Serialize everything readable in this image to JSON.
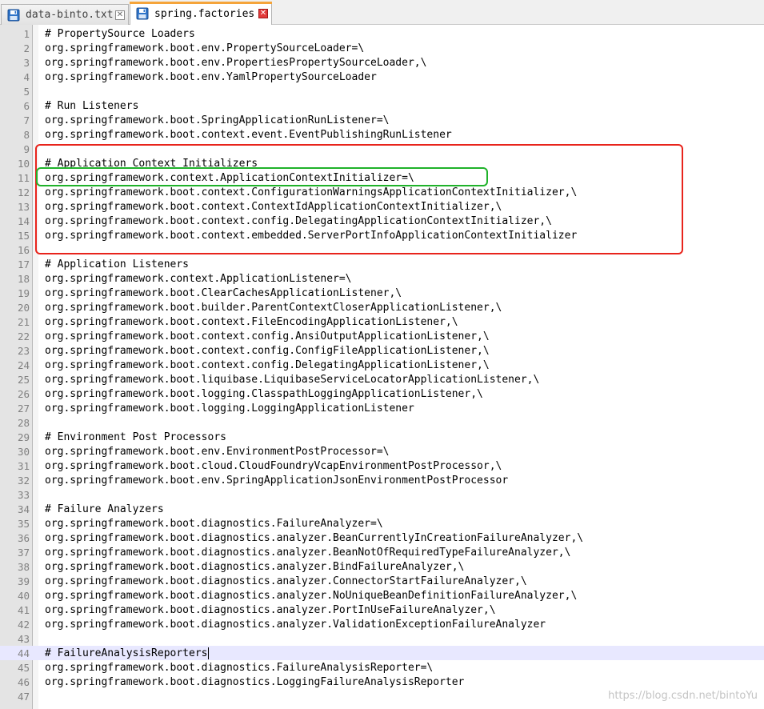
{
  "tabs": [
    {
      "title": "data-binto.txt",
      "active": false,
      "icon": "save-icon"
    },
    {
      "title": "spring.factories",
      "active": true,
      "icon": "save-icon"
    }
  ],
  "tab_close_glyph": "✕",
  "editor": {
    "current_line": 44,
    "lines": [
      "# PropertySource Loaders",
      "org.springframework.boot.env.PropertySourceLoader=\\",
      "org.springframework.boot.env.PropertiesPropertySourceLoader,\\",
      "org.springframework.boot.env.YamlPropertySourceLoader",
      "",
      "# Run Listeners",
      "org.springframework.boot.SpringApplicationRunListener=\\",
      "org.springframework.boot.context.event.EventPublishingRunListener",
      "",
      "# Application Context Initializers",
      "org.springframework.context.ApplicationContextInitializer=\\",
      "org.springframework.boot.context.ConfigurationWarningsApplicationContextInitializer,\\",
      "org.springframework.boot.context.ContextIdApplicationContextInitializer,\\",
      "org.springframework.boot.context.config.DelegatingApplicationContextInitializer,\\",
      "org.springframework.boot.context.embedded.ServerPortInfoApplicationContextInitializer",
      "",
      "# Application Listeners",
      "org.springframework.context.ApplicationListener=\\",
      "org.springframework.boot.ClearCachesApplicationListener,\\",
      "org.springframework.boot.builder.ParentContextCloserApplicationListener,\\",
      "org.springframework.boot.context.FileEncodingApplicationListener,\\",
      "org.springframework.boot.context.config.AnsiOutputApplicationListener,\\",
      "org.springframework.boot.context.config.ConfigFileApplicationListener,\\",
      "org.springframework.boot.context.config.DelegatingApplicationListener,\\",
      "org.springframework.boot.liquibase.LiquibaseServiceLocatorApplicationListener,\\",
      "org.springframework.boot.logging.ClasspathLoggingApplicationListener,\\",
      "org.springframework.boot.logging.LoggingApplicationListener",
      "",
      "# Environment Post Processors",
      "org.springframework.boot.env.EnvironmentPostProcessor=\\",
      "org.springframework.boot.cloud.CloudFoundryVcapEnvironmentPostProcessor,\\",
      "org.springframework.boot.env.SpringApplicationJsonEnvironmentPostProcessor",
      "",
      "# Failure Analyzers",
      "org.springframework.boot.diagnostics.FailureAnalyzer=\\",
      "org.springframework.boot.diagnostics.analyzer.BeanCurrentlyInCreationFailureAnalyzer,\\",
      "org.springframework.boot.diagnostics.analyzer.BeanNotOfRequiredTypeFailureAnalyzer,\\",
      "org.springframework.boot.diagnostics.analyzer.BindFailureAnalyzer,\\",
      "org.springframework.boot.diagnostics.analyzer.ConnectorStartFailureAnalyzer,\\",
      "org.springframework.boot.diagnostics.analyzer.NoUniqueBeanDefinitionFailureAnalyzer,\\",
      "org.springframework.boot.diagnostics.analyzer.PortInUseFailureAnalyzer,\\",
      "org.springframework.boot.diagnostics.analyzer.ValidationExceptionFailureAnalyzer",
      "",
      "# FailureAnalysisReporters",
      "org.springframework.boot.diagnostics.FailureAnalysisReporter=\\",
      "org.springframework.boot.diagnostics.LoggingFailureAnalysisReporter",
      ""
    ]
  },
  "annotations": {
    "red_box_color": "#e8241c",
    "green_box_color": "#1fb22a"
  },
  "watermark": "https://blog.csdn.net/bintoYu"
}
